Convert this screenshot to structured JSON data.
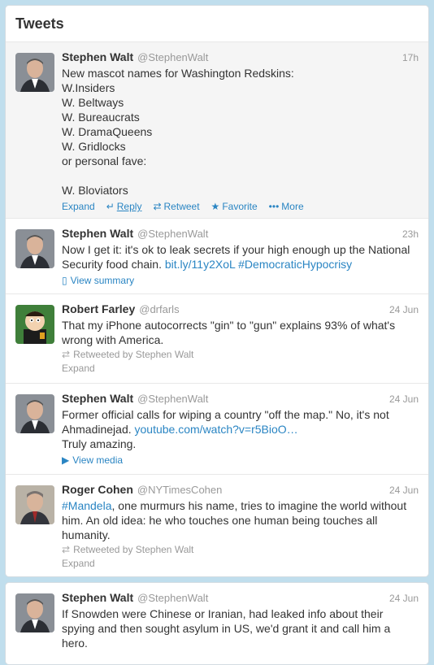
{
  "stream": {
    "title": "Tweets"
  },
  "tweets": [
    {
      "fullname": "Stephen Walt",
      "username": "@StephenWalt",
      "time": "17h",
      "text": "New mascot names for Washington Redskins:\nW.Insiders\nW. Beltways\nW. Bureaucrats\nW. DramaQueens\nW. Gridlocks\nor personal fave:\n\nW. Bloviators",
      "actions": {
        "expand": "Expand",
        "reply": "Reply",
        "retweet": "Retweet",
        "favorite": "Favorite",
        "more": "More"
      }
    },
    {
      "fullname": "Stephen Walt",
      "username": "@StephenWalt",
      "time": "23h",
      "text_1": "Now I get it: it's ok to leak secrets if your high enough up the National Security food chain.",
      "link": "bit.ly/11y2XoL",
      "hashtag": "#DemocraticHypocrisy",
      "summary_label": "View summary"
    },
    {
      "fullname": "Robert Farley",
      "username": "@drfarls",
      "time": "24 Jun",
      "text": "That my iPhone autocorrects \"gin\" to \"gun\" explains 93% of what's wrong with America.",
      "retweeted_by": "Retweeted by Stephen Walt",
      "expand": "Expand"
    },
    {
      "fullname": "Stephen Walt",
      "username": "@StephenWalt",
      "time": "24 Jun",
      "text_1": "Former official calls for wiping a country \"off the map.\"  No, it's not Ahmadinejad.",
      "link": "youtube.com/watch?v=r5BioO…",
      "text_2": "Truly amazing.",
      "media_label": "View media"
    },
    {
      "fullname": "Roger Cohen",
      "username": "@NYTimesCohen",
      "time": "24 Jun",
      "hashtag": "#Mandela",
      "text": ", one murmurs his name, tries to imagine the world without him. An old idea: he who touches one human being touches all humanity.",
      "retweeted_by": "Retweeted by Stephen Walt",
      "expand": "Expand"
    },
    {
      "fullname": "Stephen Walt",
      "username": "@StephenWalt",
      "time": "24 Jun",
      "text": "If Snowden were Chinese or Iranian, had leaked info about their spying and then sought asylum in US, we'd grant it and call him a hero."
    }
  ],
  "colors": {
    "link": "#2a85c3",
    "background": "#c0deed",
    "expanded_bg": "#f5f5f5"
  },
  "icons": {
    "reply": "reply-arrow-icon",
    "retweet": "retweet-icon",
    "favorite": "star-icon",
    "more": "more-dots-icon",
    "summary": "document-icon",
    "media": "play-icon"
  }
}
